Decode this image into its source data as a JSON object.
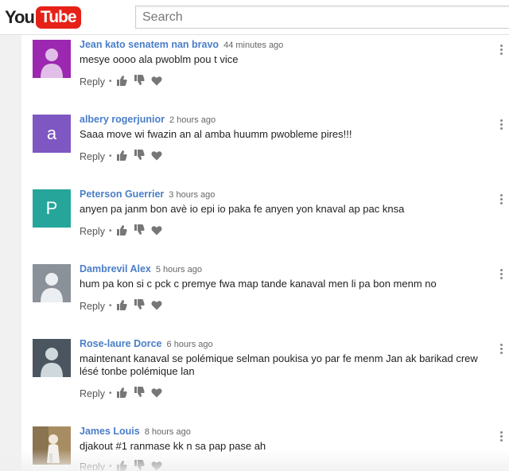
{
  "header": {
    "logo_you": "You",
    "logo_tube": "Tube",
    "search_placeholder": "Search"
  },
  "actions": {
    "reply_label": "Reply",
    "separator": "•"
  },
  "colors": {
    "brand_red": "#e62117",
    "author_blue": "#4a7ec8"
  },
  "comments": [
    {
      "author": "Jean kato senatem nan bravo",
      "time": "44 minutes ago",
      "text": "mesye oooo  ala pwoblm pou t vice",
      "avatar_type": "silhouette",
      "avatar_color": "#9c27b0"
    },
    {
      "author": "albery rogerjunior",
      "time": "2 hours ago",
      "text": "Saaa move wi  fwazin an al amba huumm pwobleme pires!!!",
      "avatar_type": "letter",
      "avatar_letter": "a",
      "avatar_color": "#7e57c2"
    },
    {
      "author": "Peterson Guerrier",
      "time": "3 hours ago",
      "text": "anyen pa janm bon avè io epi io paka fe anyen yon knaval ap pac knsa",
      "avatar_type": "letter",
      "avatar_letter": "P",
      "avatar_color": "#26a69a"
    },
    {
      "author": "Dambrevil Alex",
      "time": "5 hours ago",
      "text": "hum pa kon si c pck c premye fwa map tande kanaval men li pa bon menm no",
      "avatar_type": "silhouette",
      "avatar_color": "#8a9199"
    },
    {
      "author": "Rose-laure Dorce",
      "time": "6 hours ago",
      "text": "maintenant kanaval se polémique selman poukisa yo par fe menm Jan ak barikad crew lésé tonbe polémique lan",
      "avatar_type": "silhouette",
      "avatar_color": "#4a5560"
    },
    {
      "author": "James Louis",
      "time": "8 hours ago",
      "text": "djakout #1 ranmase kk n sa pap pase ah",
      "avatar_type": "photo",
      "avatar_color": "#b59a6e"
    }
  ]
}
